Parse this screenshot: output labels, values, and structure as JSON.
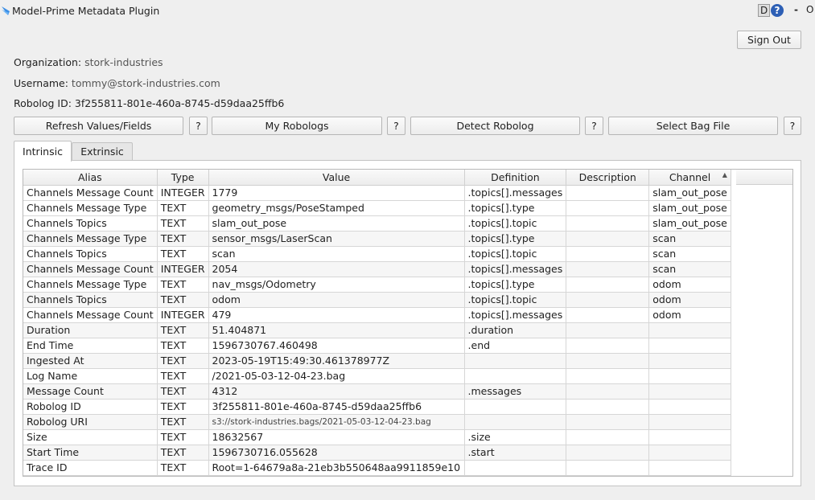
{
  "window": {
    "title": "Model-Prime Metadata Plugin",
    "btn_d": "D",
    "btn_help": "?",
    "btn_min": "-",
    "btn_o": "O"
  },
  "header": {
    "sign_out": "Sign Out",
    "organization_label": "Organization:",
    "organization": "stork-industries",
    "username_label": "Username:",
    "username": "tommy@stork-industries.com",
    "robolog_label": "Robolog ID:",
    "robolog_id": "3f255811-801e-460a-8745-d59daa25ffb6"
  },
  "toolbar": {
    "refresh": "Refresh Values/Fields",
    "my_robologs": "My Robologs",
    "detect": "Detect Robolog",
    "select_bag": "Select Bag File",
    "help": "?"
  },
  "tabs": [
    {
      "label": "Intrinsic",
      "active": true
    },
    {
      "label": "Extrinsic",
      "active": false
    }
  ],
  "table": {
    "columns": [
      "Alias",
      "Type",
      "Value",
      "Definition",
      "Description",
      "Channel"
    ],
    "sort_column": "Channel",
    "sort_order": "ascending",
    "rows": [
      [
        "Channels Message Count",
        "INTEGER",
        "1779",
        ".topics[].messages",
        "",
        "slam_out_pose"
      ],
      [
        "Channels Message Type",
        "TEXT",
        "geometry_msgs/PoseStamped",
        ".topics[].type",
        "",
        "slam_out_pose"
      ],
      [
        "Channels Topics",
        "TEXT",
        "slam_out_pose",
        ".topics[].topic",
        "",
        "slam_out_pose"
      ],
      [
        "Channels Message Type",
        "TEXT",
        "sensor_msgs/LaserScan",
        ".topics[].type",
        "",
        "scan"
      ],
      [
        "Channels Topics",
        "TEXT",
        "scan",
        ".topics[].topic",
        "",
        "scan"
      ],
      [
        "Channels Message Count",
        "INTEGER",
        "2054",
        ".topics[].messages",
        "",
        "scan"
      ],
      [
        "Channels Message Type",
        "TEXT",
        "nav_msgs/Odometry",
        ".topics[].type",
        "",
        "odom"
      ],
      [
        "Channels Topics",
        "TEXT",
        "odom",
        ".topics[].topic",
        "",
        "odom"
      ],
      [
        "Channels Message Count",
        "INTEGER",
        "479",
        ".topics[].messages",
        "",
        "odom"
      ],
      [
        "Duration",
        "TEXT",
        "51.404871",
        ".duration",
        "",
        ""
      ],
      [
        "End Time",
        "TEXT",
        "1596730767.460498",
        ".end",
        "",
        ""
      ],
      [
        "Ingested At",
        "TEXT",
        "2023-05-19T15:49:30.461378977Z",
        "",
        "",
        ""
      ],
      [
        "Log Name",
        "TEXT",
        "/2021-05-03-12-04-23.bag",
        "",
        "",
        ""
      ],
      [
        "Message Count",
        "TEXT",
        "4312",
        ".messages",
        "",
        ""
      ],
      [
        "Robolog ID",
        "TEXT",
        "3f255811-801e-460a-8745-d59daa25ffb6",
        "",
        "",
        ""
      ],
      [
        "Robolog URI",
        "TEXT",
        "s3://stork-industries.bags/2021-05-03-12-04-23.bag",
        "",
        "",
        ""
      ],
      [
        "Size",
        "TEXT",
        "18632567",
        ".size",
        "",
        ""
      ],
      [
        "Start Time",
        "TEXT",
        "1596730716.055628",
        ".start",
        "",
        ""
      ],
      [
        "Trace ID",
        "TEXT",
        "Root=1-64679a8a-21eb3b550648aa9911859e10",
        "",
        "",
        ""
      ]
    ]
  }
}
